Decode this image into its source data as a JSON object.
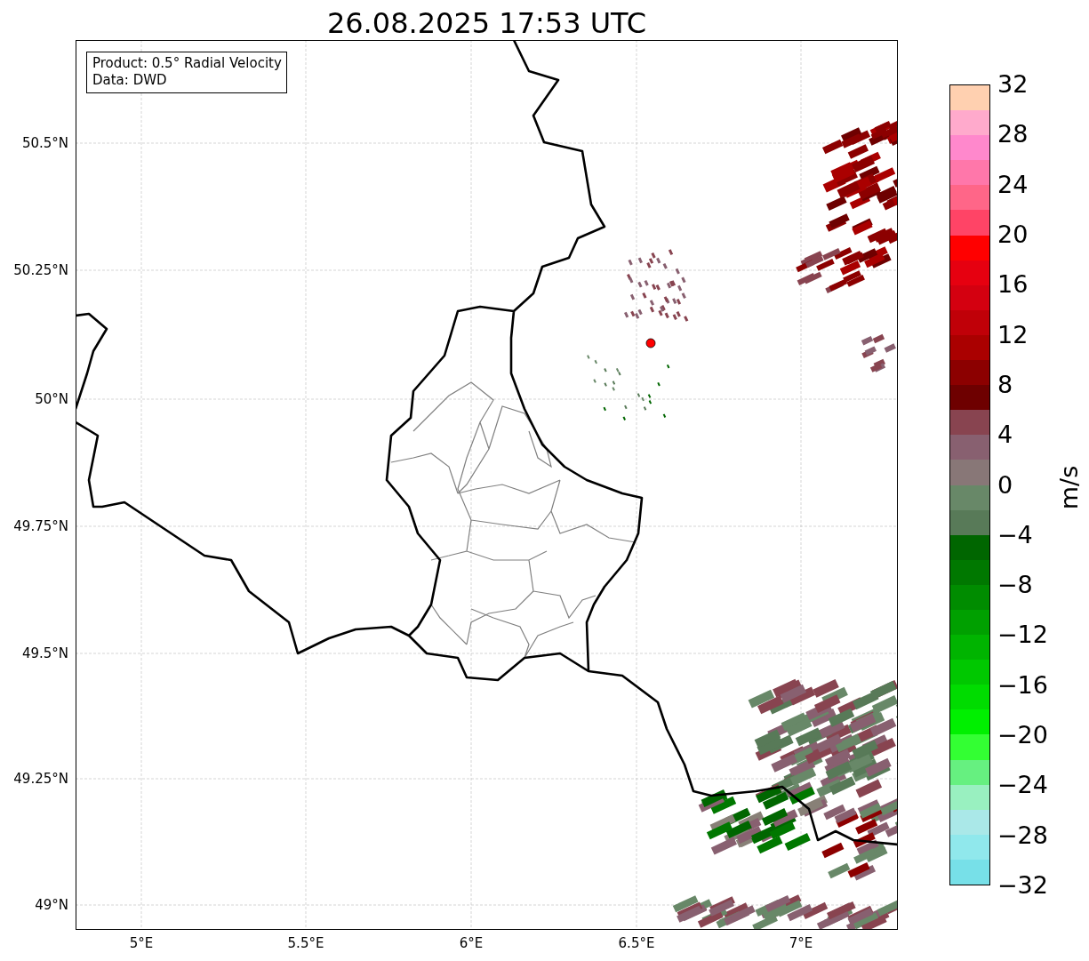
{
  "title": "26.08.2025 17:53 UTC",
  "info_box": [
    "Product: 0.5° Radial Velocity",
    "Data: DWD"
  ],
  "lat_ticks": [
    "50.5°N",
    "50.25°N",
    "50°N",
    "49.75°N",
    "49.5°N",
    "49.25°N",
    "49°N"
  ],
  "lon_ticks": [
    "5°E",
    "5.5°E",
    "6°E",
    "6.5°E",
    "7°E"
  ],
  "colorbar": {
    "label": "m/s",
    "ticks": [
      "32",
      "28",
      "24",
      "20",
      "16",
      "12",
      "8",
      "4",
      "0",
      "−4",
      "−8",
      "−12",
      "−16",
      "−20",
      "−24",
      "−28",
      "−32"
    ],
    "bins": [
      {
        "color": "#ffd0b0"
      },
      {
        "color": "#ffaacc"
      },
      {
        "color": "#ff88cc"
      },
      {
        "color": "#ff77aa"
      },
      {
        "color": "#ff6688"
      },
      {
        "color": "#ff4466"
      },
      {
        "color": "#ff0000"
      },
      {
        "color": "#e60010"
      },
      {
        "color": "#d40010"
      },
      {
        "color": "#c00008"
      },
      {
        "color": "#aa0000"
      },
      {
        "color": "#8c0000"
      },
      {
        "color": "#6e0000"
      },
      {
        "color": "#884450"
      },
      {
        "color": "#886070"
      },
      {
        "color": "#887777"
      },
      {
        "color": "#688868"
      },
      {
        "color": "#587a58"
      },
      {
        "color": "#006600"
      },
      {
        "color": "#007800"
      },
      {
        "color": "#008c00"
      },
      {
        "color": "#00a000"
      },
      {
        "color": "#00b400"
      },
      {
        "color": "#00c800"
      },
      {
        "color": "#00dc00"
      },
      {
        "color": "#00f000"
      },
      {
        "color": "#33ff33"
      },
      {
        "color": "#66f080"
      },
      {
        "color": "#99f0c0"
      },
      {
        "color": "#aae8e8"
      },
      {
        "color": "#90e8ec"
      },
      {
        "color": "#77e0e8"
      }
    ]
  }
}
